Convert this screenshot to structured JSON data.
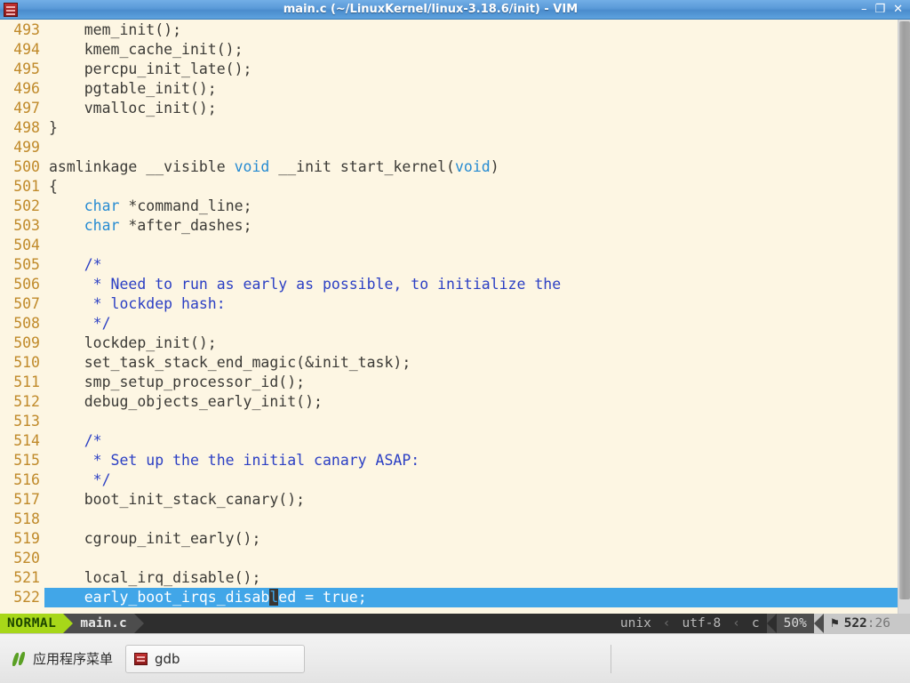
{
  "titlebar": {
    "title": "main.c (~/LinuxKernel/linux-3.18.6/init) - VIM",
    "app_icon": "terminal-icon",
    "minimize": "–",
    "maximize": "❐",
    "close": "✕"
  },
  "editor": {
    "filetype": "c",
    "background": "#fdf6e3",
    "linenr_color": "#c08a2a",
    "cursorline_color": "#41a6e8",
    "keyword_color": "#268bd2",
    "comment_color": "#2b3fc4",
    "cursor_line_number": 522,
    "cursor_column": 26,
    "lines": [
      {
        "num": 493,
        "segments": [
          {
            "t": "    mem_init();",
            "c": ""
          }
        ]
      },
      {
        "num": 494,
        "segments": [
          {
            "t": "    kmem_cache_init();",
            "c": ""
          }
        ]
      },
      {
        "num": 495,
        "segments": [
          {
            "t": "    percpu_init_late();",
            "c": ""
          }
        ]
      },
      {
        "num": 496,
        "segments": [
          {
            "t": "    pgtable_init();",
            "c": ""
          }
        ]
      },
      {
        "num": 497,
        "segments": [
          {
            "t": "    vmalloc_init();",
            "c": ""
          }
        ]
      },
      {
        "num": 498,
        "segments": [
          {
            "t": "}",
            "c": ""
          }
        ]
      },
      {
        "num": 499,
        "segments": [
          {
            "t": "",
            "c": ""
          }
        ]
      },
      {
        "num": 500,
        "segments": [
          {
            "t": "asmlinkage __visible ",
            "c": ""
          },
          {
            "t": "void",
            "c": "kw"
          },
          {
            "t": " __init start_kernel(",
            "c": ""
          },
          {
            "t": "void",
            "c": "kw"
          },
          {
            "t": ")",
            "c": ""
          }
        ]
      },
      {
        "num": 501,
        "segments": [
          {
            "t": "{",
            "c": ""
          }
        ]
      },
      {
        "num": 502,
        "segments": [
          {
            "t": "    ",
            "c": ""
          },
          {
            "t": "char",
            "c": "kw"
          },
          {
            "t": " *command_line;",
            "c": ""
          }
        ]
      },
      {
        "num": 503,
        "segments": [
          {
            "t": "    ",
            "c": ""
          },
          {
            "t": "char",
            "c": "kw"
          },
          {
            "t": " *after_dashes;",
            "c": ""
          }
        ]
      },
      {
        "num": 504,
        "segments": [
          {
            "t": "",
            "c": ""
          }
        ]
      },
      {
        "num": 505,
        "segments": [
          {
            "t": "    /*",
            "c": "cmt"
          }
        ]
      },
      {
        "num": 506,
        "segments": [
          {
            "t": "     * Need to run as early as possible, to initialize the",
            "c": "cmt"
          }
        ]
      },
      {
        "num": 507,
        "segments": [
          {
            "t": "     * lockdep hash:",
            "c": "cmt"
          }
        ]
      },
      {
        "num": 508,
        "segments": [
          {
            "t": "     */",
            "c": "cmt"
          }
        ]
      },
      {
        "num": 509,
        "segments": [
          {
            "t": "    lockdep_init();",
            "c": ""
          }
        ]
      },
      {
        "num": 510,
        "segments": [
          {
            "t": "    set_task_stack_end_magic(&init_task);",
            "c": ""
          }
        ]
      },
      {
        "num": 511,
        "segments": [
          {
            "t": "    smp_setup_processor_id();",
            "c": ""
          }
        ]
      },
      {
        "num": 512,
        "segments": [
          {
            "t": "    debug_objects_early_init();",
            "c": ""
          }
        ]
      },
      {
        "num": 513,
        "segments": [
          {
            "t": "",
            "c": ""
          }
        ]
      },
      {
        "num": 514,
        "segments": [
          {
            "t": "    /*",
            "c": "cmt"
          }
        ]
      },
      {
        "num": 515,
        "segments": [
          {
            "t": "     * Set up the the initial canary ASAP:",
            "c": "cmt"
          }
        ]
      },
      {
        "num": 516,
        "segments": [
          {
            "t": "     */",
            "c": "cmt"
          }
        ]
      },
      {
        "num": 517,
        "segments": [
          {
            "t": "    boot_init_stack_canary();",
            "c": ""
          }
        ]
      },
      {
        "num": 518,
        "segments": [
          {
            "t": "",
            "c": ""
          }
        ]
      },
      {
        "num": 519,
        "segments": [
          {
            "t": "    cgroup_init_early();",
            "c": ""
          }
        ]
      },
      {
        "num": 520,
        "segments": [
          {
            "t": "",
            "c": ""
          }
        ]
      },
      {
        "num": 521,
        "segments": [
          {
            "t": "    local_irq_disable();",
            "c": ""
          }
        ]
      },
      {
        "num": 522,
        "cursorline": true,
        "segments": [
          {
            "t": "    early_boot_irqs_disab",
            "c": ""
          },
          {
            "t": "l",
            "c": "cur"
          },
          {
            "t": "ed = true;",
            "c": ""
          }
        ]
      }
    ]
  },
  "statusline": {
    "mode": "NORMAL",
    "filename": "main.c",
    "fileformat": "unix",
    "encoding": "utf-8",
    "filetype": "c",
    "percent": "50%",
    "position_line": "522",
    "position_sep": ":",
    "position_col": "26",
    "position_icon": "⚑",
    "sep_glyph": "‹"
  },
  "taskbar": {
    "applications_menu": "应用程序菜单",
    "menu_icon": "xfce-mouse-logo",
    "window_button": "gdb",
    "window_button_icon": "terminal-icon"
  }
}
